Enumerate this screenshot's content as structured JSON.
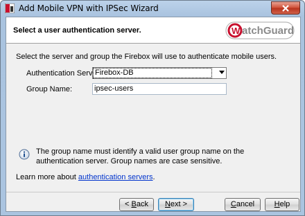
{
  "window": {
    "title": "Add Mobile VPN with IPSec Wizard"
  },
  "header": {
    "title": "Select a user authentication server.",
    "logo_text": "WatchGuard"
  },
  "form": {
    "intro": "Select the server and group the Firebox will use to authenticate mobile users.",
    "server_label": "Authentication Server:",
    "server_value": "Firebox-DB",
    "group_label": "Group Name:",
    "group_value": "ipsec-users"
  },
  "info": {
    "text": "The group name must identify a valid user group name on the authentication server. Group names are case sensitive."
  },
  "learn": {
    "prefix": "Learn more about",
    "link": "authentication servers",
    "suffix": "."
  },
  "buttons": {
    "back_prefix": "< ",
    "back_accel": "B",
    "back_rest": "ack",
    "next_accel": "N",
    "next_rest": "ext >",
    "cancel_accel": "C",
    "cancel_rest": "ancel",
    "help_accel": "H",
    "help_rest": "elp"
  },
  "colors": {
    "accent_brand": "#c8102e",
    "link": "#0033cc"
  }
}
